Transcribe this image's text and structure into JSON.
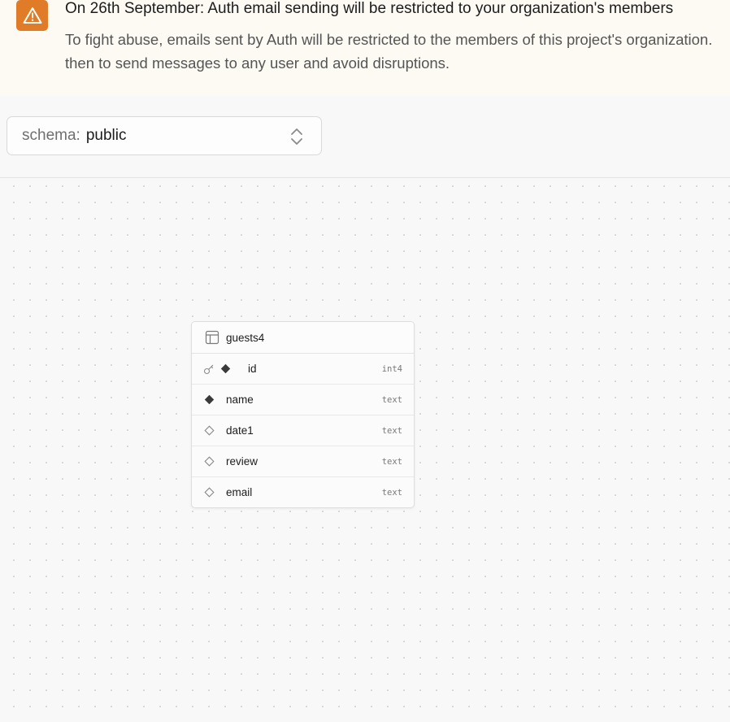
{
  "banner": {
    "title": "On 26th September: Auth email sending will be restricted to your organization's members",
    "body_line1": "To fight abuse, emails sent by Auth will be restricted to the members of this project's organization.",
    "body_line2": "then to send messages to any user and avoid disruptions.",
    "icon": "warning-triangle-icon",
    "accent_color": "#e07b28"
  },
  "schema_select": {
    "prefix": "schema:",
    "value": "public",
    "icon": "chevron-up-down-icon"
  },
  "table": {
    "name": "guests4",
    "icon": "table-icon",
    "columns": [
      {
        "name": "id",
        "type": "int4",
        "primary_key": true,
        "nullable": false
      },
      {
        "name": "name",
        "type": "text",
        "primary_key": false,
        "nullable": false
      },
      {
        "name": "date1",
        "type": "text",
        "primary_key": false,
        "nullable": true
      },
      {
        "name": "review",
        "type": "text",
        "primary_key": false,
        "nullable": true
      },
      {
        "name": "email",
        "type": "text",
        "primary_key": false,
        "nullable": true
      }
    ]
  }
}
